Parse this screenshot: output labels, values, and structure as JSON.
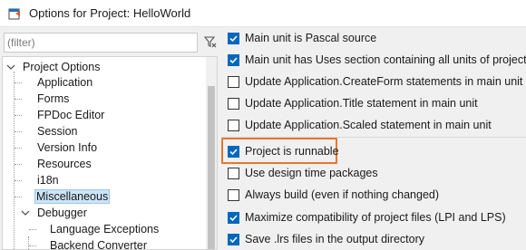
{
  "window": {
    "title": "Options for Project: HelloWorld"
  },
  "filter": {
    "placeholder": "(filter)"
  },
  "tree": {
    "items": [
      {
        "label": "Project Options",
        "level": 0,
        "expanded": true
      },
      {
        "label": "Application",
        "level": 1
      },
      {
        "label": "Forms",
        "level": 1
      },
      {
        "label": "FPDoc Editor",
        "level": 1
      },
      {
        "label": "Session",
        "level": 1
      },
      {
        "label": "Version Info",
        "level": 1
      },
      {
        "label": "Resources",
        "level": 1
      },
      {
        "label": "i18n",
        "level": 1
      },
      {
        "label": "Miscellaneous",
        "level": 1,
        "selected": true
      },
      {
        "label": "Debugger",
        "level": 1,
        "expanded": true
      },
      {
        "label": "Language Exceptions",
        "level": 2
      },
      {
        "label": "Backend Converter",
        "level": 2
      }
    ]
  },
  "options": [
    {
      "label": "Main unit is Pascal source",
      "checked": true
    },
    {
      "label": "Main unit has Uses section containing all units of project",
      "checked": true
    },
    {
      "label": "Update Application.CreateForm statements in main unit",
      "checked": false
    },
    {
      "label": "Update Application.Title statement in main unit",
      "checked": false
    },
    {
      "label": "Update Application.Scaled statement in main unit",
      "checked": false
    },
    {
      "label": "Project is runnable",
      "checked": true
    },
    {
      "label": "Use design time packages",
      "checked": false
    },
    {
      "label": "Always build (even if nothing changed)",
      "checked": false
    },
    {
      "label": "Maximize compatibility of project files (LPI and LPS)",
      "checked": true
    },
    {
      "label": "Save .lrs files in the output directory",
      "checked": true
    }
  ],
  "colors": {
    "accent": "#0067c0",
    "highlight_border": "#e8762c",
    "selection": "#cce4f7"
  }
}
